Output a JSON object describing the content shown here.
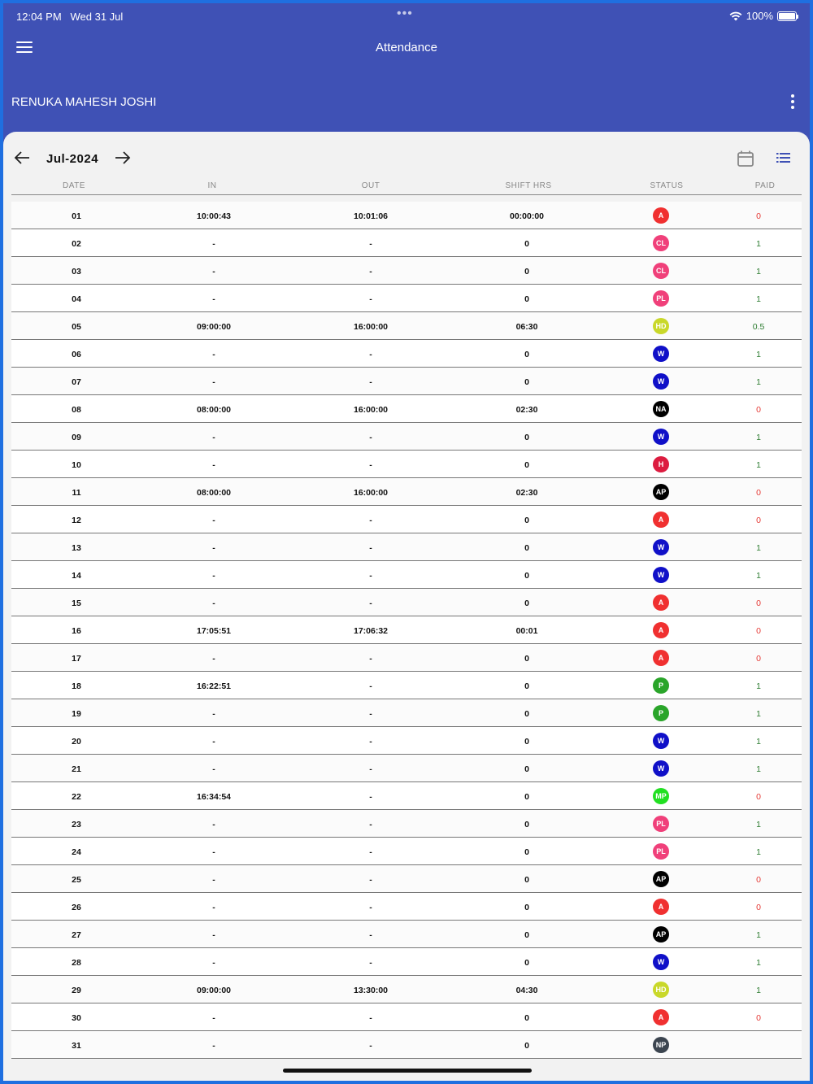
{
  "status_bar": {
    "time": "12:04 PM",
    "date": "Wed 31 Jul",
    "dots": "•••",
    "battery": "100%",
    "battery_level": 1.0
  },
  "appbar": {
    "title": "Attendance",
    "menu_icon": "hamburger-menu-icon"
  },
  "employee": {
    "name": "RENUKA MAHESH JOSHI",
    "more_icon": "more-vertical-icon"
  },
  "month_nav": {
    "label": "Jul-2024",
    "prev_icon": "arrow-left-icon",
    "next_icon": "arrow-right-icon",
    "calendar_icon": "calendar-icon",
    "list_icon": "list-view-icon"
  },
  "columns": {
    "date": "DATE",
    "in": "IN",
    "out": "OUT",
    "shift": "SHIFT HRS",
    "status": "STATUS",
    "paid": "PAID"
  },
  "colors": {
    "A": "#f03030",
    "CL": "#f0407a",
    "PL": "#f0407a",
    "HD": "#c9d82a",
    "W": "#1010c8",
    "NA": "#000000",
    "H": "#dc1c40",
    "AP": "#000000",
    "P": "#2aa52a",
    "MP": "#22e022",
    "NP": "#3c4550",
    "paid_zero": "#e53935",
    "paid_positive": "#2e7d32"
  },
  "rows": [
    {
      "date": "01",
      "in": "10:00:43",
      "out": "10:01:06",
      "shift": "00:00:00",
      "status": "A",
      "paid": "0"
    },
    {
      "date": "02",
      "in": "-",
      "out": "-",
      "shift": "0",
      "status": "CL",
      "paid": "1"
    },
    {
      "date": "03",
      "in": "-",
      "out": "-",
      "shift": "0",
      "status": "CL",
      "paid": "1"
    },
    {
      "date": "04",
      "in": "-",
      "out": "-",
      "shift": "0",
      "status": "PL",
      "paid": "1"
    },
    {
      "date": "05",
      "in": "09:00:00",
      "out": "16:00:00",
      "shift": "06:30",
      "status": "HD",
      "paid": "0.5"
    },
    {
      "date": "06",
      "in": "-",
      "out": "-",
      "shift": "0",
      "status": "W",
      "paid": "1"
    },
    {
      "date": "07",
      "in": "-",
      "out": "-",
      "shift": "0",
      "status": "W",
      "paid": "1"
    },
    {
      "date": "08",
      "in": "08:00:00",
      "out": "16:00:00",
      "shift": "02:30",
      "status": "NA",
      "paid": "0"
    },
    {
      "date": "09",
      "in": "-",
      "out": "-",
      "shift": "0",
      "status": "W",
      "paid": "1"
    },
    {
      "date": "10",
      "in": "-",
      "out": "-",
      "shift": "0",
      "status": "H",
      "paid": "1"
    },
    {
      "date": "11",
      "in": "08:00:00",
      "out": "16:00:00",
      "shift": "02:30",
      "status": "AP",
      "paid": "0"
    },
    {
      "date": "12",
      "in": "-",
      "out": "-",
      "shift": "0",
      "status": "A",
      "paid": "0"
    },
    {
      "date": "13",
      "in": "-",
      "out": "-",
      "shift": "0",
      "status": "W",
      "paid": "1"
    },
    {
      "date": "14",
      "in": "-",
      "out": "-",
      "shift": "0",
      "status": "W",
      "paid": "1"
    },
    {
      "date": "15",
      "in": "-",
      "out": "-",
      "shift": "0",
      "status": "A",
      "paid": "0"
    },
    {
      "date": "16",
      "in": "17:05:51",
      "out": "17:06:32",
      "shift": "00:01",
      "status": "A",
      "paid": "0"
    },
    {
      "date": "17",
      "in": "-",
      "out": "-",
      "shift": "0",
      "status": "A",
      "paid": "0"
    },
    {
      "date": "18",
      "in": "16:22:51",
      "out": "-",
      "shift": "0",
      "status": "P",
      "paid": "1"
    },
    {
      "date": "19",
      "in": "-",
      "out": "-",
      "shift": "0",
      "status": "P",
      "paid": "1"
    },
    {
      "date": "20",
      "in": "-",
      "out": "-",
      "shift": "0",
      "status": "W",
      "paid": "1"
    },
    {
      "date": "21",
      "in": "-",
      "out": "-",
      "shift": "0",
      "status": "W",
      "paid": "1"
    },
    {
      "date": "22",
      "in": "16:34:54",
      "out": "-",
      "shift": "0",
      "status": "MP",
      "paid": "0"
    },
    {
      "date": "23",
      "in": "-",
      "out": "-",
      "shift": "0",
      "status": "PL",
      "paid": "1"
    },
    {
      "date": "24",
      "in": "-",
      "out": "-",
      "shift": "0",
      "status": "PL",
      "paid": "1"
    },
    {
      "date": "25",
      "in": "-",
      "out": "-",
      "shift": "0",
      "status": "AP",
      "paid": "0"
    },
    {
      "date": "26",
      "in": "-",
      "out": "-",
      "shift": "0",
      "status": "A",
      "paid": "0"
    },
    {
      "date": "27",
      "in": "-",
      "out": "-",
      "shift": "0",
      "status": "AP",
      "paid": "1"
    },
    {
      "date": "28",
      "in": "-",
      "out": "-",
      "shift": "0",
      "status": "W",
      "paid": "1"
    },
    {
      "date": "29",
      "in": "09:00:00",
      "out": "13:30:00",
      "shift": "04:30",
      "status": "HD",
      "paid": "1"
    },
    {
      "date": "30",
      "in": "-",
      "out": "-",
      "shift": "0",
      "status": "A",
      "paid": "0"
    },
    {
      "date": "31",
      "in": "-",
      "out": "-",
      "shift": "0",
      "status": "NP",
      "paid": ""
    }
  ]
}
